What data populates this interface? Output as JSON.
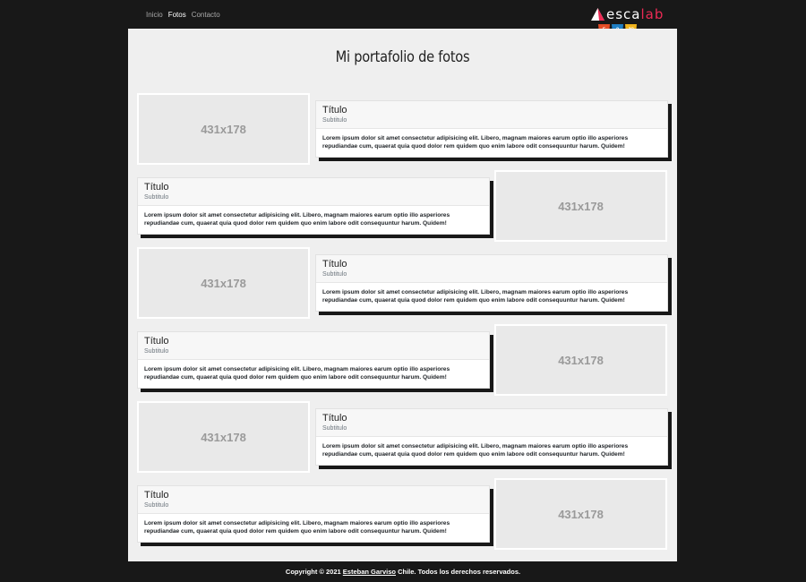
{
  "nav": {
    "links": [
      {
        "label": "Inicio",
        "active": false
      },
      {
        "label": "Fotos",
        "active": true
      },
      {
        "label": "Contacto",
        "active": false
      }
    ]
  },
  "brand": {
    "name_part1": "esca",
    "name_part2": "lab",
    "accent_color": "#ec2a54",
    "badges": [
      "5",
      "3",
      "JS"
    ]
  },
  "page": {
    "title": "Mi portafolio de fotos"
  },
  "rows": [
    {
      "layout": "image-left",
      "placeholder": "431x178",
      "title": "Título",
      "subtitle": "Subtitulo",
      "text": "Lorem ipsum dolor sit amet consectetur adipisicing elit. Libero, magnam maiores earum optio illo asperiores repudiandae cum, quaerat quia quod dolor rem quidem quo enim labore odit consequuntur harum. Quidem!"
    },
    {
      "layout": "image-right",
      "placeholder": "431x178",
      "title": "Título",
      "subtitle": "Subtitulo",
      "text": "Lorem ipsum dolor sit amet consectetur adipisicing elit. Libero, magnam maiores earum optio illo asperiores repudiandae cum, quaerat quia quod dolor rem quidem quo enim labore odit consequuntur harum. Quidem!"
    },
    {
      "layout": "image-left",
      "placeholder": "431x178",
      "title": "Título",
      "subtitle": "Subtitulo",
      "text": "Lorem ipsum dolor sit amet consectetur adipisicing elit. Libero, magnam maiores earum optio illo asperiores repudiandae cum, quaerat quia quod dolor rem quidem quo enim labore odit consequuntur harum. Quidem!"
    },
    {
      "layout": "image-right",
      "placeholder": "431x178",
      "title": "Título",
      "subtitle": "Subtitulo",
      "text": "Lorem ipsum dolor sit amet consectetur adipisicing elit. Libero, magnam maiores earum optio illo asperiores repudiandae cum, quaerat quia quod dolor rem quidem quo enim labore odit consequuntur harum. Quidem!"
    },
    {
      "layout": "image-left",
      "placeholder": "431x178",
      "title": "Título",
      "subtitle": "Subtitulo",
      "text": "Lorem ipsum dolor sit amet consectetur adipisicing elit. Libero, magnam maiores earum optio illo asperiores repudiandae cum, quaerat quia quod dolor rem quidem quo enim labore odit consequuntur harum. Quidem!"
    },
    {
      "layout": "image-right",
      "placeholder": "431x178",
      "title": "Título",
      "subtitle": "Subtitulo",
      "text": "Lorem ipsum dolor sit amet consectetur adipisicing elit. Libero, magnam maiores earum optio illo asperiores repudiandae cum, quaerat quia quod dolor rem quidem quo enim labore odit consequuntur harum. Quidem!"
    }
  ],
  "footer": {
    "prefix": "Copyright © 2021",
    "author_link": "Esteban Garviso",
    "suffix": "Chile. Todos los derechos reservados."
  }
}
